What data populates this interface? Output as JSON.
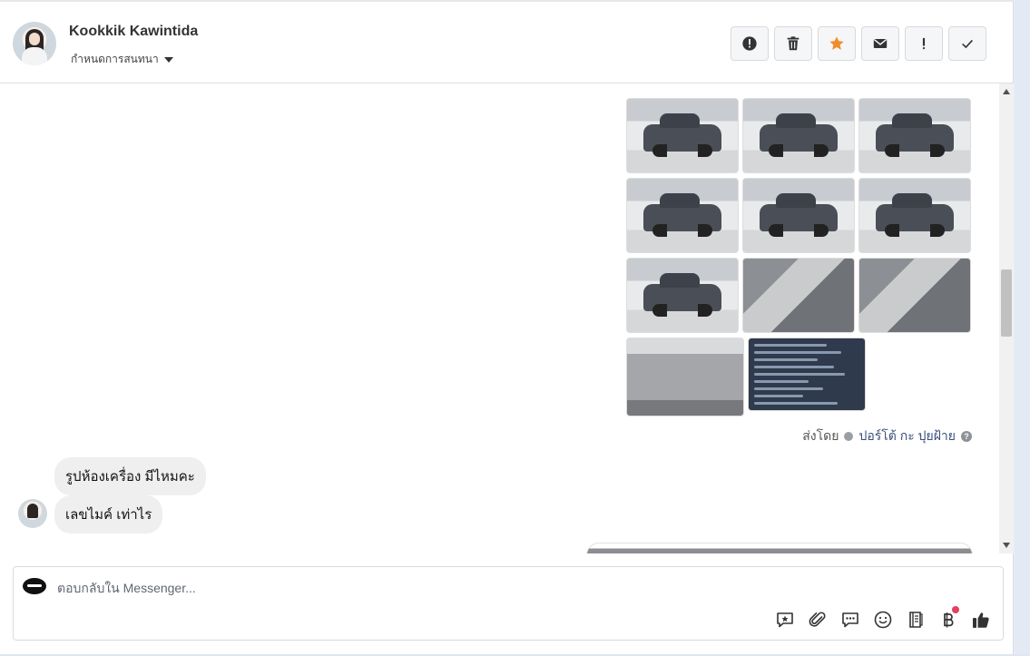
{
  "header": {
    "contact_name": "Kookkik Kawintida",
    "assign_label": "กำหนดการสนทนา",
    "actions": [
      {
        "name": "report-button",
        "icon": "alert-circle-icon"
      },
      {
        "name": "delete-button",
        "icon": "trash-icon"
      },
      {
        "name": "star-button",
        "icon": "star-icon"
      },
      {
        "name": "mail-button",
        "icon": "envelope-icon"
      },
      {
        "name": "important-button",
        "icon": "exclamation-icon"
      },
      {
        "name": "done-button",
        "icon": "check-icon"
      }
    ],
    "star_color": "#f28c28"
  },
  "chat": {
    "photo_grid_count": 11,
    "sent_by_prefix": "ส่งโดย",
    "sent_by_name": "ปอร์โต้ กะ ปุยฝ้าย",
    "messages": [
      {
        "text": "รูปห้องเครื่อง มีไหมคะ"
      },
      {
        "text": "เลขไมค์ เท่าไร"
      }
    ]
  },
  "composer": {
    "placeholder": "ตอบกลับใน Messenger...",
    "tools": [
      "saved-reply-icon",
      "attachment-icon",
      "chat-bubbles-icon",
      "emoji-icon",
      "notes-icon",
      "baht-payment-icon",
      "thumbs-up-icon"
    ],
    "notification_color": "#e4405f"
  }
}
